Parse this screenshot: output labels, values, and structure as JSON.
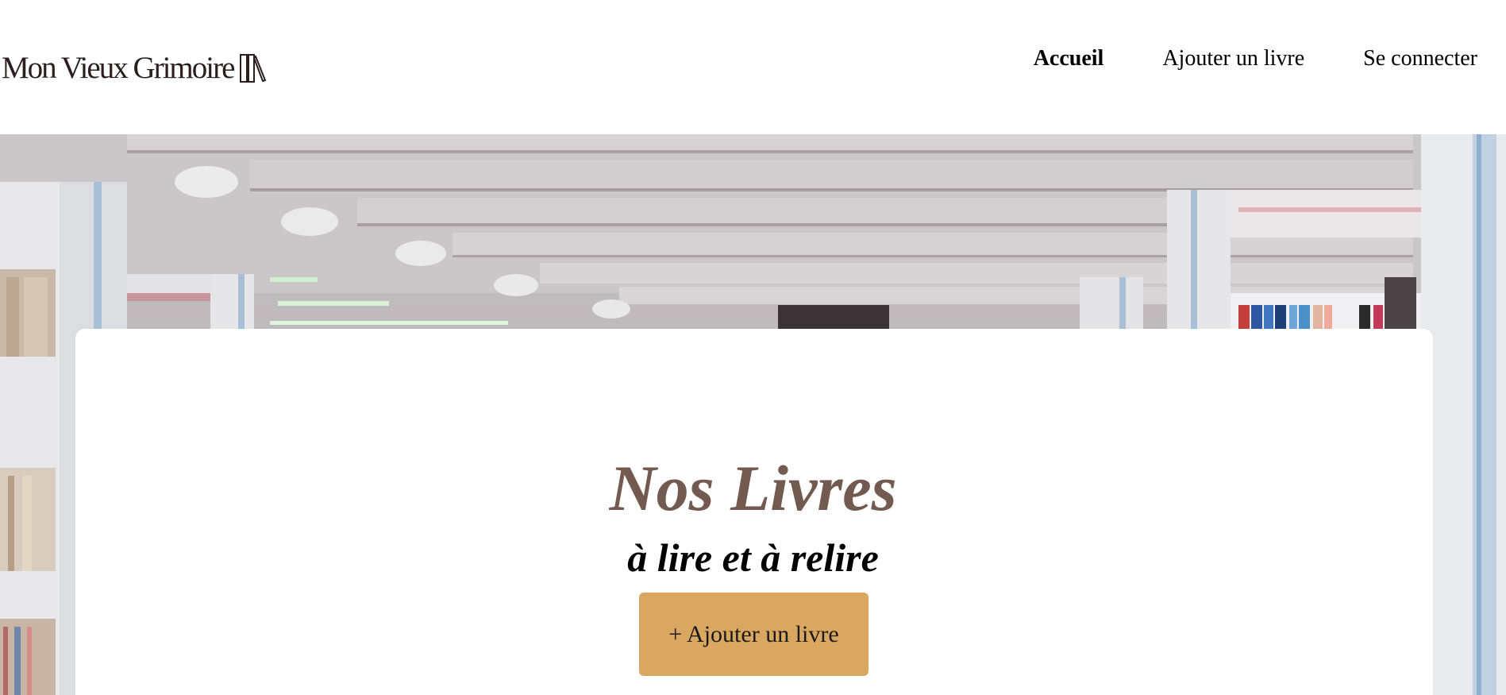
{
  "header": {
    "logo_text": "Mon Vieux Grimoire",
    "logo_icon": "books-icon",
    "nav": [
      {
        "label": "Accueil",
        "active": true
      },
      {
        "label": "Ajouter un livre",
        "active": false
      },
      {
        "label": "Se connecter",
        "active": false
      }
    ]
  },
  "hero": {
    "image": "library-shelves-photo"
  },
  "main": {
    "title": "Nos Livres",
    "subtitle": "à lire et à relire",
    "add_button_label": "+ Ajouter un livre"
  },
  "colors": {
    "title": "#735a50",
    "button": "#d9a75f",
    "logo": "#2a1f1d"
  }
}
